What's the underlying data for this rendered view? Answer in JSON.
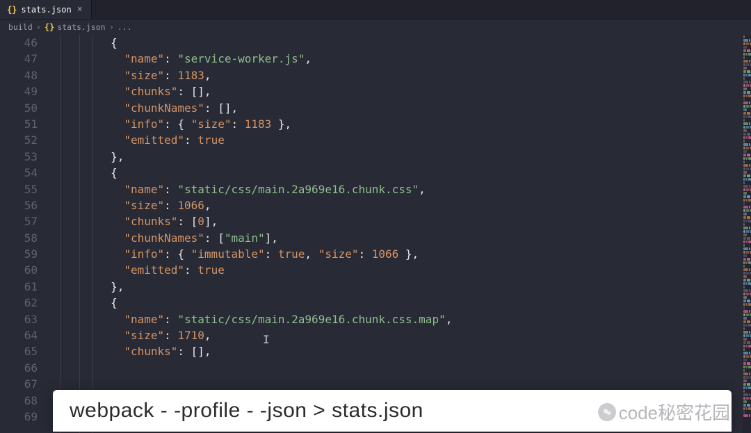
{
  "tab": {
    "filename": "stats.json",
    "icon": "{}"
  },
  "breadcrumb": {
    "parts": [
      "build",
      "stats.json",
      "..."
    ]
  },
  "gutter": {
    "start": 46,
    "end": 69
  },
  "code": {
    "lines": [
      [
        [
          "punct",
          "        {"
        ]
      ],
      [
        [
          "punct",
          "          "
        ],
        [
          "key",
          "\"name\""
        ],
        [
          "punct",
          ": "
        ],
        [
          "str",
          "\"service-worker.js\""
        ],
        [
          "punct",
          ","
        ]
      ],
      [
        [
          "punct",
          "          "
        ],
        [
          "key",
          "\"size\""
        ],
        [
          "punct",
          ": "
        ],
        [
          "num",
          "1183"
        ],
        [
          "punct",
          ","
        ]
      ],
      [
        [
          "punct",
          "          "
        ],
        [
          "key",
          "\"chunks\""
        ],
        [
          "punct",
          ": [],"
        ]
      ],
      [
        [
          "punct",
          "          "
        ],
        [
          "key",
          "\"chunkNames\""
        ],
        [
          "punct",
          ": [],"
        ]
      ],
      [
        [
          "punct",
          "          "
        ],
        [
          "key",
          "\"info\""
        ],
        [
          "punct",
          ": { "
        ],
        [
          "key",
          "\"size\""
        ],
        [
          "punct",
          ": "
        ],
        [
          "num",
          "1183"
        ],
        [
          "punct",
          " },"
        ]
      ],
      [
        [
          "punct",
          "          "
        ],
        [
          "key",
          "\"emitted\""
        ],
        [
          "punct",
          ": "
        ],
        [
          "bool",
          "true"
        ]
      ],
      [
        [
          "punct",
          "        },"
        ]
      ],
      [
        [
          "punct",
          "        {"
        ]
      ],
      [
        [
          "punct",
          "          "
        ],
        [
          "key",
          "\"name\""
        ],
        [
          "punct",
          ": "
        ],
        [
          "str",
          "\"static/css/main.2a969e16.chunk.css\""
        ],
        [
          "punct",
          ","
        ]
      ],
      [
        [
          "punct",
          "          "
        ],
        [
          "key",
          "\"size\""
        ],
        [
          "punct",
          ": "
        ],
        [
          "num",
          "1066"
        ],
        [
          "punct",
          ","
        ]
      ],
      [
        [
          "punct",
          "          "
        ],
        [
          "key",
          "\"chunks\""
        ],
        [
          "punct",
          ": ["
        ],
        [
          "num",
          "0"
        ],
        [
          "punct",
          "],"
        ]
      ],
      [
        [
          "punct",
          "          "
        ],
        [
          "key",
          "\"chunkNames\""
        ],
        [
          "punct",
          ": ["
        ],
        [
          "str",
          "\"main\""
        ],
        [
          "punct",
          "],"
        ]
      ],
      [
        [
          "punct",
          "          "
        ],
        [
          "key",
          "\"info\""
        ],
        [
          "punct",
          ": { "
        ],
        [
          "key",
          "\"immutable\""
        ],
        [
          "punct",
          ": "
        ],
        [
          "bool",
          "true"
        ],
        [
          "punct",
          ", "
        ],
        [
          "key",
          "\"size\""
        ],
        [
          "punct",
          ": "
        ],
        [
          "num",
          "1066"
        ],
        [
          "punct",
          " },"
        ]
      ],
      [
        [
          "punct",
          "          "
        ],
        [
          "key",
          "\"emitted\""
        ],
        [
          "punct",
          ": "
        ],
        [
          "bool",
          "true"
        ]
      ],
      [
        [
          "punct",
          "        },"
        ]
      ],
      [
        [
          "punct",
          "        {"
        ]
      ],
      [
        [
          "punct",
          "          "
        ],
        [
          "key",
          "\"name\""
        ],
        [
          "punct",
          ": "
        ],
        [
          "str",
          "\"static/css/main.2a969e16.chunk.css.map\""
        ],
        [
          "punct",
          ","
        ]
      ],
      [
        [
          "punct",
          "          "
        ],
        [
          "key",
          "\"size\""
        ],
        [
          "punct",
          ": "
        ],
        [
          "num",
          "1710"
        ],
        [
          "punct",
          ","
        ]
      ],
      [
        [
          "punct",
          "          "
        ],
        [
          "key",
          "\"chunks\""
        ],
        [
          "punct",
          ": [],"
        ]
      ],
      [
        [
          "punct",
          ""
        ]
      ],
      [
        [
          "punct",
          ""
        ]
      ],
      [
        [
          "punct",
          ""
        ]
      ],
      [
        [
          "punct",
          ""
        ]
      ]
    ]
  },
  "overlay": {
    "command": "webpack - -profile - -json  > stats.json"
  },
  "watermark": {
    "text": "code秘密花园"
  },
  "minimap_colors": [
    "#7fae6e",
    "#b87a4a",
    "#c96a8a",
    "#6aa0c9",
    "#5e6272"
  ]
}
